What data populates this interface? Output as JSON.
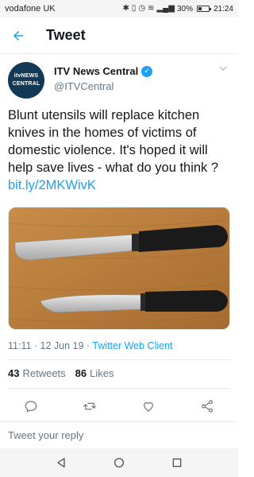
{
  "status_bar": {
    "carrier": "vodafone UK",
    "battery": "30%",
    "battery_level": 0.3,
    "time": "21:24",
    "icons": [
      "bluetooth-icon",
      "vibrate-icon",
      "alarm-icon",
      "wifi-icon",
      "signal-icon"
    ]
  },
  "app_bar": {
    "title": "Tweet",
    "back_icon": "arrow-left-icon"
  },
  "tweet": {
    "author": {
      "avatar_line1": "itvNEWS",
      "avatar_line2": "CENTRAL",
      "name": "ITV News Central",
      "handle": "@ITVCentral",
      "verified": true
    },
    "text": "Blunt utensils will replace kitchen knives in the homes of victims of domestic violence. It's hoped it will help save lives - what do you think ? ",
    "link": "bit.ly/2MKWivK",
    "media": {
      "description_icon": "knives-photo"
    },
    "timestamp": "11:11 · 12 Jun 19 · ",
    "client": "Twitter Web Client",
    "retweets": "43",
    "retweets_label": "Retweets",
    "likes": "86",
    "likes_label": "Likes"
  },
  "actions": [
    "reply-icon",
    "retweet-icon",
    "like-icon",
    "share-icon"
  ],
  "reply_bar": {
    "placeholder": "Tweet your reply"
  },
  "colors": {
    "accent": "#1da1f2",
    "text": "#14171a",
    "muted": "#657786",
    "avatar_bg": "#123a56"
  }
}
